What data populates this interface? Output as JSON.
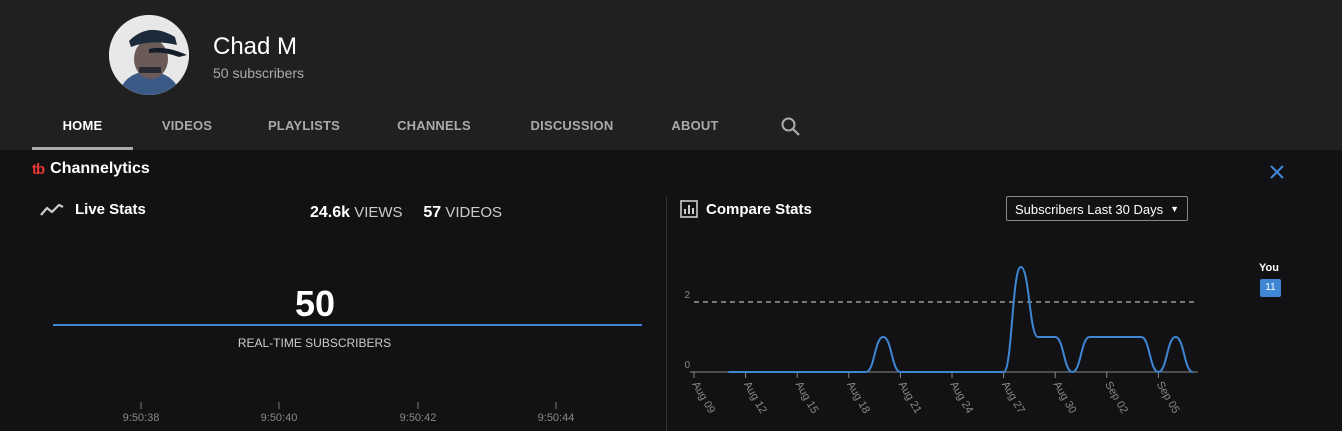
{
  "channel": {
    "name": "Chad M",
    "subscribers": "50 subscribers"
  },
  "tabs": [
    {
      "label": "HOME",
      "active": true
    },
    {
      "label": "VIDEOS",
      "active": false
    },
    {
      "label": "PLAYLISTS",
      "active": false
    },
    {
      "label": "CHANNELS",
      "active": false
    },
    {
      "label": "DISCUSSION",
      "active": false
    },
    {
      "label": "ABOUT",
      "active": false
    }
  ],
  "channelytics": {
    "logo": "tb",
    "title": "Channelytics"
  },
  "live_stats": {
    "title": "Live Stats",
    "views_value": "24.6k",
    "views_label": "VIEWS",
    "videos_value": "57",
    "videos_label": "VIDEOS",
    "subscriber_count": "50",
    "subscriber_label": "REAL-TIME SUBSCRIBERS",
    "times": [
      "9:50:38",
      "9:50:40",
      "9:50:42",
      "9:50:44"
    ]
  },
  "compare": {
    "title": "Compare Stats",
    "dropdown": "Subscribers Last 30 Days",
    "you_label": "You",
    "you_badge": "11"
  },
  "chart_data": {
    "type": "line",
    "x_ticks": [
      "Aug 09",
      "Aug 12",
      "Aug 15",
      "Aug 18",
      "Aug 21",
      "Aug 24",
      "Aug 27",
      "Aug 30",
      "Sep 02",
      "Sep 05"
    ],
    "y_ticks": [
      "0",
      "2"
    ],
    "ylim": [
      0,
      3
    ],
    "reference_line": 2,
    "series": [
      {
        "color": "#3f86d4",
        "x": [
          "Aug 11",
          "Aug 12",
          "Aug 13",
          "Aug 14",
          "Aug 15",
          "Aug 16",
          "Aug 17",
          "Aug 18",
          "Aug 19",
          "Aug 20",
          "Aug 21",
          "Aug 22",
          "Aug 23",
          "Aug 24",
          "Aug 25",
          "Aug 26",
          "Aug 27",
          "Aug 28",
          "Aug 29",
          "Aug 30",
          "Aug 31",
          "Sep 01",
          "Sep 02",
          "Sep 03",
          "Sep 04",
          "Sep 05",
          "Sep 06",
          "Sep 07"
        ],
        "values": [
          0,
          0,
          0,
          0,
          0,
          0,
          0,
          0,
          0,
          1,
          0,
          0,
          0,
          0,
          0,
          0,
          0,
          3,
          1,
          1,
          0,
          1,
          1,
          1,
          1,
          0,
          1,
          0
        ]
      }
    ]
  }
}
